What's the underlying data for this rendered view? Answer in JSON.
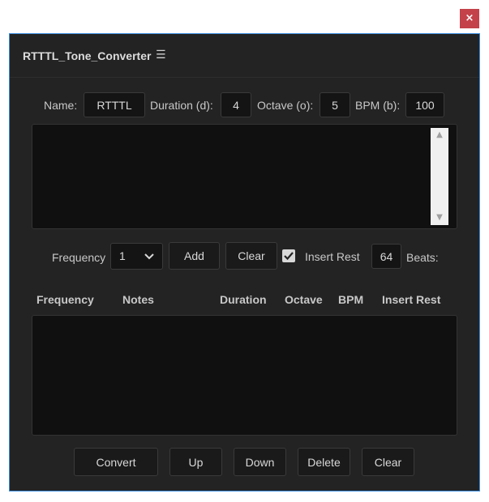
{
  "window": {
    "close_label": "×",
    "title": "RTTTL_Tone_Converter",
    "menu_icon": "hamburger-menu-icon"
  },
  "header_fields": {
    "name_label": "Name:",
    "name_value": "RTTTL",
    "duration_label": "Duration (d):",
    "duration_value": "4",
    "octave_label": "Octave (o):",
    "octave_value": "5",
    "bpm_label": "BPM (b):",
    "bpm_value": "100"
  },
  "editor": {
    "scroll_up": "▲",
    "scroll_down": "▼"
  },
  "frequency_row": {
    "frequency_label": "Frequency",
    "frequency_selected": "1",
    "add_label": "Add",
    "clear_label": "Clear",
    "insert_rest_checked": true,
    "insert_rest_label": "Insert Rest",
    "beats_value": "64",
    "beats_label": "Beats:"
  },
  "table": {
    "columns": [
      "Frequency",
      "Notes",
      "Duration",
      "Octave",
      "BPM",
      "Insert Rest"
    ],
    "rows": []
  },
  "actions": {
    "convert_label": "Convert",
    "up_label": "Up",
    "down_label": "Down",
    "delete_label": "Delete",
    "clear_label": "Clear"
  },
  "colors": {
    "panel_bg": "#232323",
    "accent_border": "#3b8de0",
    "close_bg": "#c4424a"
  }
}
